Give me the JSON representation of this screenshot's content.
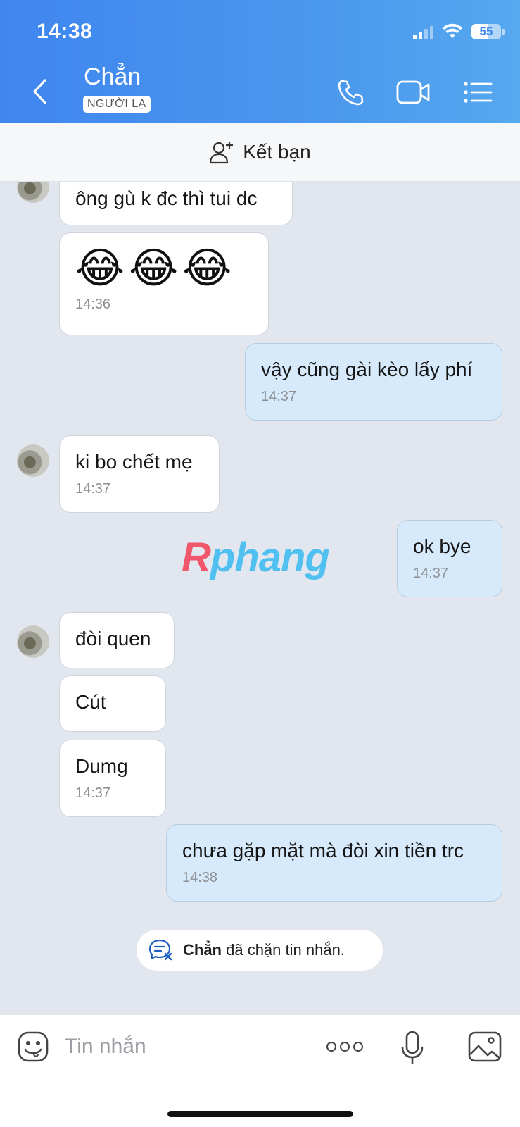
{
  "status_bar": {
    "time": "14:38",
    "battery": "55"
  },
  "header": {
    "contact_name": "Chẳn",
    "badge": "NGƯỜI LẠ"
  },
  "add_friend": {
    "label": "Kết bạn"
  },
  "messages": [
    {
      "side": "in",
      "text": "ông gù k đc thì tui dc"
    },
    {
      "side": "in",
      "emoji": "😂😂😂",
      "time": "14:36"
    },
    {
      "side": "out",
      "text": "vậy cũng gài kèo lấy phí",
      "time": "14:37"
    },
    {
      "side": "in",
      "text": "ki bo chết mẹ",
      "time": "14:37"
    },
    {
      "side": "out",
      "text": "ok bye",
      "time": "14:37"
    },
    {
      "side": "in",
      "text": "đòi quen"
    },
    {
      "side": "in",
      "text": "Cút"
    },
    {
      "side": "in",
      "text": "Dumg",
      "time": "14:37"
    },
    {
      "side": "out",
      "text": "chưa gặp mặt mà đòi xin tiền trc",
      "time": "14:38"
    }
  ],
  "watermark": {
    "first": "R",
    "rest": "phang"
  },
  "blocked_notice": {
    "name": "Chẳn",
    "text": " đã chặn tin nhắn."
  },
  "composer": {
    "placeholder": "Tin nhắn"
  },
  "colors": {
    "header_start": "#3f86ef",
    "header_end": "#56a8ef",
    "outgoing_bubble": "#d6eafb",
    "chat_bg": "#e2e7ef"
  },
  "icons": [
    "back-arrow-icon",
    "phone-icon",
    "video-call-icon",
    "menu-list-icon",
    "add-friend-icon",
    "blocked-chat-icon",
    "sticker-icon",
    "more-icon",
    "mic-icon",
    "image-icon"
  ]
}
